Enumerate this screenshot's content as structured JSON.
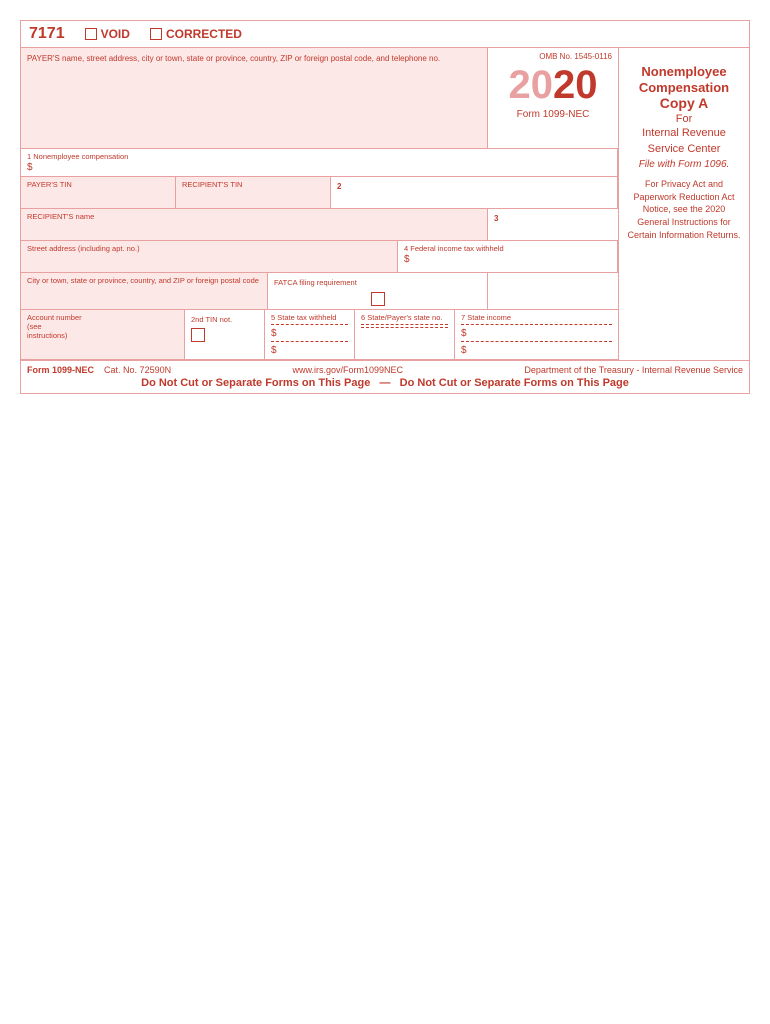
{
  "form": {
    "number": "7171",
    "void_label": "VOID",
    "corrected_label": "CORRECTED",
    "omb_number": "OMB No. 1545-0116",
    "year_part1": "20",
    "year_part2": "20",
    "form_name": "Form 1099-NEC",
    "title_line1": "Nonemployee",
    "title_line2": "Compensation",
    "copy_label": "Copy A",
    "copy_for": "For",
    "copy_org1": "Internal Revenue",
    "copy_org2": "Service Center",
    "file_with": "File with Form 1096.",
    "privacy_notice": "For Privacy Act and Paperwork Reduction Act Notice, see the 2020 General Instructions for Certain Information Returns.",
    "fields": {
      "payer_info_label": "PAYER'S name, street address, city or town, state or province, country, ZIP or foreign postal code, and telephone no.",
      "box1_label": "1  Nonemployee compensation",
      "box1_dollar": "$",
      "box2_label": "2",
      "payer_tin_label": "PAYER'S TIN",
      "recipient_tin_label": "RECIPIENT'S TIN",
      "recipient_name_label": "RECIPIENT'S name",
      "box3_label": "3",
      "street_label": "Street address (including apt. no.)",
      "box4_label": "4  Federal income tax withheld",
      "box4_dollar": "$",
      "city_label": "City or town, state or province, country, and ZIP or foreign postal code",
      "fatca_label": "FATCA filing requirement",
      "account_label": "Account number (see instructions)",
      "second_tin_label": "2nd TIN not.",
      "box5_label": "5  State tax withheld",
      "box5_dollar1": "$",
      "box5_dollar2": "$",
      "box6_label": "6  State/Payer's state no.",
      "box7_label": "7  State income",
      "box7_dollar1": "$",
      "box7_dollar2": "$"
    },
    "footer": {
      "form_label": "Form 1099-NEC",
      "cat_no": "Cat. No. 72590N",
      "website": "www.irs.gov/Form1099NEC",
      "dept": "Department of the Treasury - Internal Revenue Service",
      "do_not_cut": "Do Not Cut or Separate Forms on This Page",
      "dash": "—",
      "do_not_cut2": "Do Not Cut or Separate Forms on This Page"
    }
  }
}
